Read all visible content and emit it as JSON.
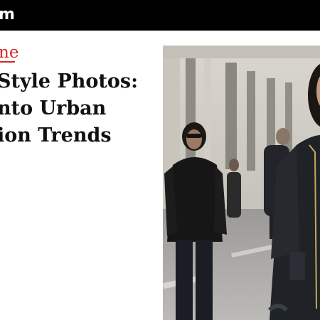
{
  "header": {
    "brand_fragment": "m"
  },
  "article": {
    "section_fragment": "ne",
    "headline_lines": [
      "Style Photos:",
      "nto Urban",
      "ion Trends"
    ]
  },
  "photo": {
    "subject": "street-style-photo"
  },
  "colors": {
    "topbar": "#000000",
    "accent": "#d62828",
    "text": "#111111",
    "background": "#ffffff"
  }
}
